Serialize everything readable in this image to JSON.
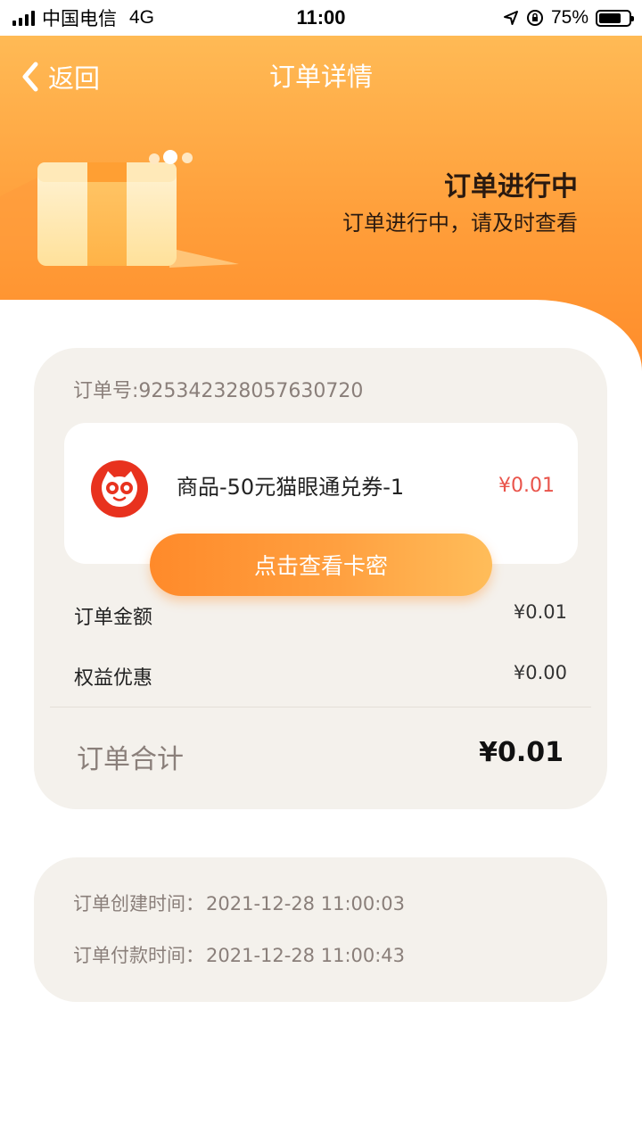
{
  "status_bar": {
    "carrier": "中国电信",
    "network": "4G",
    "time": "11:00",
    "battery_percent": "75%",
    "battery_level": 0.75
  },
  "header": {
    "back_label": "返回",
    "title": "订单详情",
    "status_title": "订单进行中",
    "status_subtitle": "订单进行中，请及时查看"
  },
  "order": {
    "order_number": "订单号:925342328057630720",
    "goods": {
      "name": "商品-50元猫眼通兑券-1",
      "price": "¥0.01",
      "logo_icon": "maoyan-cat-logo-icon"
    },
    "view_code_button": "点击查看卡密",
    "rows": [
      {
        "label": "订单金额",
        "value": "¥0.01"
      },
      {
        "label": "权益优惠",
        "value": "¥0.00"
      }
    ],
    "total_label": "订单合计",
    "total_value": "¥0.01"
  },
  "times": {
    "created_label": "订单创建时间：",
    "created_value": "2021-12-28 11:00:03",
    "paid_label": "订单付款时间：",
    "paid_value": "2021-12-28 11:00:43"
  },
  "colors": {
    "header_orange": "#ff9e3a",
    "price_red": "#e9544b",
    "card_bg": "#f4f1ec"
  }
}
